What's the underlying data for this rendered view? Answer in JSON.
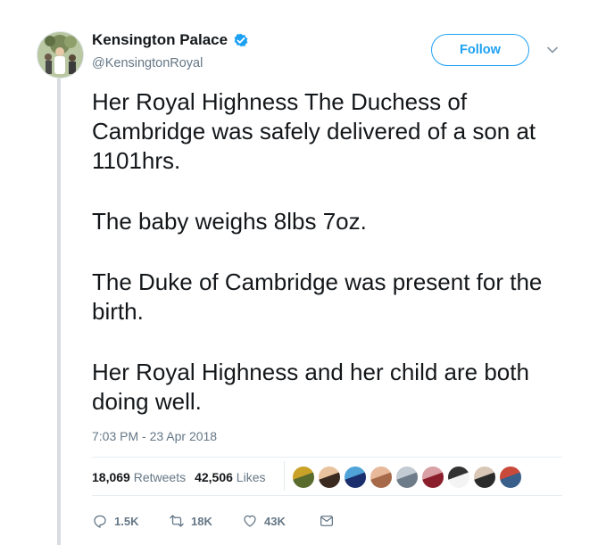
{
  "account": {
    "display_name": "Kensington Palace",
    "handle": "@KensingtonRoyal",
    "verified": true,
    "follow_label": "Follow"
  },
  "tweet": {
    "paragraphs": [
      "Her Royal Highness The Duchess of Cambridge was safely delivered of a son at 1101hrs.",
      "The baby weighs 8lbs 7oz.",
      "The Duke of Cambridge was present for the birth.",
      "Her Royal Highness and her child are both doing well."
    ],
    "timestamp": "7:03 PM - 23 Apr 2018"
  },
  "stats": {
    "retweets_count": "18,069",
    "retweets_label": "Retweets",
    "likes_count": "42,506",
    "likes_label": "Likes"
  },
  "likers": [
    {
      "name": "liker-1",
      "colors": [
        "#5a6b2e",
        "#c9a227"
      ]
    },
    {
      "name": "liker-2",
      "colors": [
        "#3a2a20",
        "#e8c39e"
      ]
    },
    {
      "name": "liker-3",
      "colors": [
        "#1b2f6e",
        "#4fa3d9"
      ]
    },
    {
      "name": "liker-4",
      "colors": [
        "#a66a4a",
        "#e7b89a"
      ]
    },
    {
      "name": "liker-5",
      "colors": [
        "#6e7b88",
        "#c3cbd3"
      ]
    },
    {
      "name": "liker-6",
      "colors": [
        "#8a1f2b",
        "#d9a0a6"
      ]
    },
    {
      "name": "liker-7",
      "colors": [
        "#f4f4f4",
        "#333333"
      ]
    },
    {
      "name": "liker-8",
      "colors": [
        "#2b2b2b",
        "#d8c7b6"
      ]
    },
    {
      "name": "liker-9",
      "colors": [
        "#3a5f8a",
        "#c94a3a"
      ]
    }
  ],
  "actions": {
    "reply_count": "1.5K",
    "retweet_count": "18K",
    "like_count": "43K"
  },
  "colors": {
    "accent": "#1da1f2",
    "muted": "#657786",
    "text": "#14171a"
  }
}
